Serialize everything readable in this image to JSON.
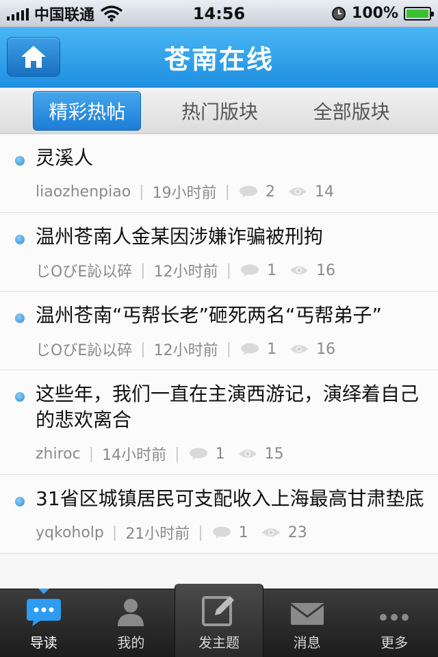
{
  "status_bar": {
    "carrier": "中国联通",
    "time": "14:56",
    "battery": "100%",
    "battery_level": 1.0,
    "icons": [
      "signal-icon",
      "wifi-icon",
      "clock-icon",
      "battery-icon"
    ]
  },
  "header": {
    "title": "苍南在线",
    "home_icon": "home-icon"
  },
  "tabs": [
    {
      "label": "精彩热帖",
      "active": true
    },
    {
      "label": "热门版块",
      "active": false
    },
    {
      "label": "全部版块",
      "active": false
    }
  ],
  "posts": [
    {
      "title": "灵溪人",
      "author": "liaozhenpiao",
      "time": "19小时前",
      "replies": "2",
      "views": "14"
    },
    {
      "title": "温州苍南人金某因涉嫌诈骗被刑拘",
      "author": "じOびE訫以碎",
      "time": "12小时前",
      "replies": "1",
      "views": "16"
    },
    {
      "title": "温州苍南“丐帮长老”砸死两名“丐帮弟子”",
      "author": "じOびE訫以碎",
      "time": "12小时前",
      "replies": "1",
      "views": "16"
    },
    {
      "title": "这些年，我们一直在主演西游记，演绎着自己的悲欢离合",
      "author": "zhiroc",
      "time": "14小时前",
      "replies": "1",
      "views": "15"
    },
    {
      "title": "31省区城镇居民可支配收入上海最高甘肃垫底",
      "author": "yqkoholp",
      "time": "21小时前",
      "replies": "1",
      "views": "23"
    }
  ],
  "tabbar": [
    {
      "label": "导读",
      "icon": "chat-bubble-icon",
      "active": true
    },
    {
      "label": "我的",
      "icon": "user-icon",
      "active": false
    },
    {
      "label": "发主题",
      "icon": "compose-icon",
      "active": false
    },
    {
      "label": "消息",
      "icon": "envelope-icon",
      "active": false
    },
    {
      "label": "更多",
      "icon": "more-dots-icon",
      "active": false
    }
  ],
  "colors": {
    "header_blue": "#1f8fe0",
    "active_tab": "#1d7cd6",
    "bullet": "#2f8fd6",
    "tabbar_bg": "#2a2a2a"
  }
}
